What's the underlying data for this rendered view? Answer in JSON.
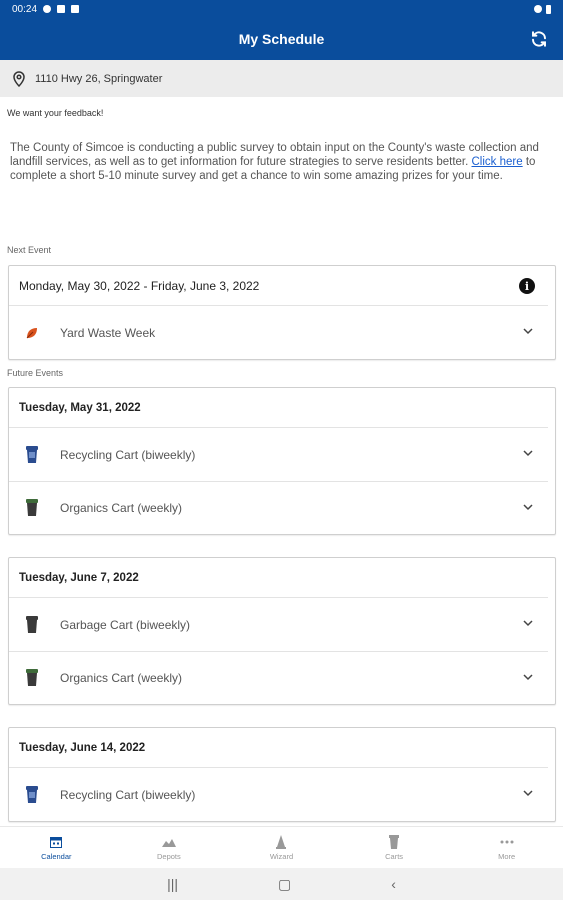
{
  "status_bar": {
    "time": "00:24"
  },
  "app_bar": {
    "title": "My Schedule",
    "refresh_icon": "refresh-icon"
  },
  "address": {
    "text": "1110 Hwy 26, Springwater",
    "icon": "location-pin-icon"
  },
  "feedback": {
    "title": "We want your feedback!",
    "text_before": "The County of Simcoe is conducting a public survey to obtain input on the County's waste collection and landfill services, as well as to get information for future strategies to serve residents better. ",
    "link_text": "Click here",
    "text_after": " to complete a short 5-10 minute survey and get a chance to win some amazing prizes for your time."
  },
  "next_event": {
    "label": "Next Event",
    "date_range": "Monday, May 30, 2022 - Friday, June 3, 2022",
    "item": "Yard Waste Week"
  },
  "future_events": {
    "label": "Future Events",
    "groups": [
      {
        "date": "Tuesday, May 31, 2022",
        "items": [
          "Recycling Cart (biweekly)",
          "Organics Cart (weekly)"
        ]
      },
      {
        "date": "Tuesday, June 7, 2022",
        "items": [
          "Garbage Cart (biweekly)",
          "Organics Cart (weekly)"
        ]
      },
      {
        "date": "Tuesday, June 14, 2022",
        "items": [
          "Recycling Cart (biweekly)"
        ]
      }
    ]
  },
  "bottom_nav": {
    "items": [
      "Calendar",
      "Depots",
      "Wizard",
      "Carts",
      "More"
    ],
    "active": "Calendar"
  },
  "colors": {
    "primary": "#0a4d9c",
    "link": "#1a5fd0",
    "recycling": "#2a4c8f",
    "organics": "#3f6b3a",
    "garbage": "#3a3a3a",
    "yard": "#d9531e"
  }
}
